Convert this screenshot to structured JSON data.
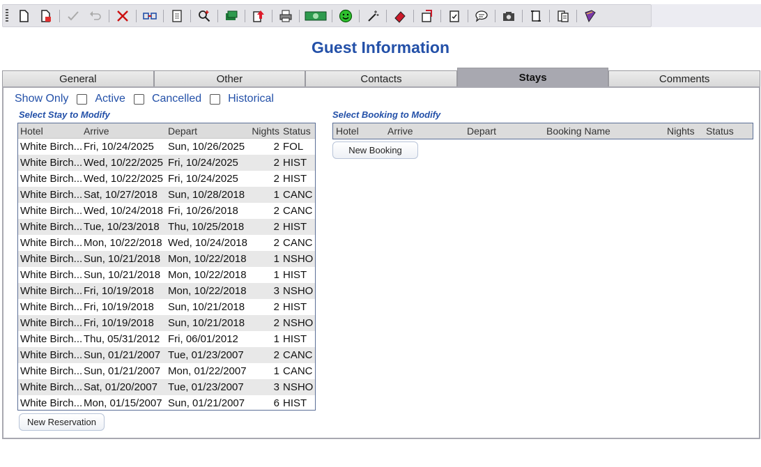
{
  "toolbar": {
    "icons": [
      "new-document-icon",
      "copy-document-icon",
      "check-icon",
      "undo-icon",
      "delete-icon",
      "merge-icon",
      "notes-icon",
      "search-icon",
      "money-icon",
      "export-icon",
      "print-icon",
      "cash-icon",
      "smiley-icon",
      "magic-wand-icon",
      "eraser-icon",
      "package-icon",
      "checklist-icon",
      "message-icon",
      "camera-icon",
      "scroll-icon",
      "clipboard-icon",
      "book-icon"
    ]
  },
  "page": {
    "title": "Guest Information"
  },
  "tabs": [
    {
      "label": "General",
      "active": false
    },
    {
      "label": "Other",
      "active": false
    },
    {
      "label": "Contacts",
      "active": false
    },
    {
      "label": "Stays",
      "active": true
    },
    {
      "label": "Comments",
      "active": false
    }
  ],
  "filters": {
    "label": "Show Only",
    "options": [
      {
        "label": "Active",
        "checked": false
      },
      {
        "label": "Cancelled",
        "checked": false
      },
      {
        "label": "Historical",
        "checked": false
      }
    ]
  },
  "stays": {
    "section_title": "Select Stay to Modify",
    "columns": [
      "Hotel",
      "Arrive",
      "Depart",
      "Nights",
      "Status"
    ],
    "rows": [
      [
        "White Birch...",
        "Fri, 10/24/2025",
        "Sun, 10/26/2025",
        "2",
        "FOL"
      ],
      [
        "White Birch...",
        "Wed, 10/22/2025",
        "Fri, 10/24/2025",
        "2",
        "HIST"
      ],
      [
        "White Birch...",
        "Wed, 10/22/2025",
        "Fri, 10/24/2025",
        "2",
        "HIST"
      ],
      [
        "White Birch...",
        "Sat, 10/27/2018",
        "Sun, 10/28/2018",
        "1",
        "CANC"
      ],
      [
        "White Birch...",
        "Wed, 10/24/2018",
        "Fri, 10/26/2018",
        "2",
        "CANC"
      ],
      [
        "White Birch...",
        "Tue, 10/23/2018",
        "Thu, 10/25/2018",
        "2",
        "HIST"
      ],
      [
        "White Birch...",
        "Mon, 10/22/2018",
        "Wed, 10/24/2018",
        "2",
        "CANC"
      ],
      [
        "White Birch...",
        "Sun, 10/21/2018",
        "Mon, 10/22/2018",
        "1",
        "NSHO"
      ],
      [
        "White Birch...",
        "Sun, 10/21/2018",
        "Mon, 10/22/2018",
        "1",
        "HIST"
      ],
      [
        "White Birch...",
        "Fri, 10/19/2018",
        "Mon, 10/22/2018",
        "3",
        "NSHO"
      ],
      [
        "White Birch...",
        "Fri, 10/19/2018",
        "Sun, 10/21/2018",
        "2",
        "HIST"
      ],
      [
        "White Birch...",
        "Fri, 10/19/2018",
        "Sun, 10/21/2018",
        "2",
        "NSHO"
      ],
      [
        "White Birch...",
        "Thu, 05/31/2012",
        "Fri, 06/01/2012",
        "1",
        "HIST"
      ],
      [
        "White Birch...",
        "Sun, 01/21/2007",
        "Tue, 01/23/2007",
        "2",
        "CANC"
      ],
      [
        "White Birch...",
        "Sun, 01/21/2007",
        "Mon, 01/22/2007",
        "1",
        "CANC"
      ],
      [
        "White Birch...",
        "Sat, 01/20/2007",
        "Tue, 01/23/2007",
        "3",
        "NSHO"
      ],
      [
        "White Birch...",
        "Mon, 01/15/2007",
        "Sun, 01/21/2007",
        "6",
        "HIST"
      ]
    ],
    "new_button": "New Reservation"
  },
  "bookings": {
    "section_title": "Select Booking to Modify",
    "columns": [
      "Hotel",
      "Arrive",
      "Depart",
      "Booking Name",
      "Nights",
      "Status"
    ],
    "rows": [],
    "new_button": "New Booking"
  }
}
